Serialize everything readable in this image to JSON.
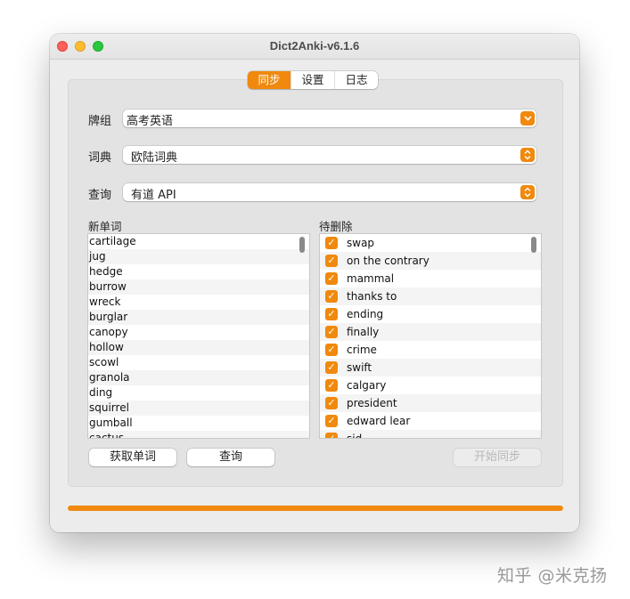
{
  "window": {
    "title": "Dict2Anki-v6.1.6"
  },
  "tabs": [
    {
      "label": "同步",
      "active": true
    },
    {
      "label": "设置",
      "active": false
    },
    {
      "label": "日志",
      "active": false
    }
  ],
  "fields": {
    "deck": {
      "label": "牌组",
      "value": "高考英语"
    },
    "dictionary": {
      "label": "词典",
      "value": "欧陆词典"
    },
    "query": {
      "label": "查询",
      "value": "有道 API"
    }
  },
  "new_words": {
    "label": "新单词",
    "items": [
      "cartilage",
      "jug",
      "hedge",
      "burrow",
      "wreck",
      "burglar",
      "canopy",
      "hollow",
      "scowl",
      "granola",
      "ding",
      "squirrel",
      "gumball",
      "cactus"
    ]
  },
  "to_delete": {
    "label": "待删除",
    "items": [
      "swap",
      "on the contrary",
      "mammal",
      "thanks to",
      "ending",
      "finally",
      "crime",
      "swift",
      "calgary",
      "president",
      "edward lear",
      "sid"
    ]
  },
  "buttons": {
    "fetch": "获取单词",
    "query": "查询",
    "sync": "开始同步"
  },
  "progress": {
    "value": 1.0
  },
  "colors": {
    "accent": "#f0890d"
  },
  "icons": {
    "checkbox": "checkmark-icon",
    "select_arrow": "chevron-updown-icon"
  },
  "watermark": "知乎 @米克扬"
}
